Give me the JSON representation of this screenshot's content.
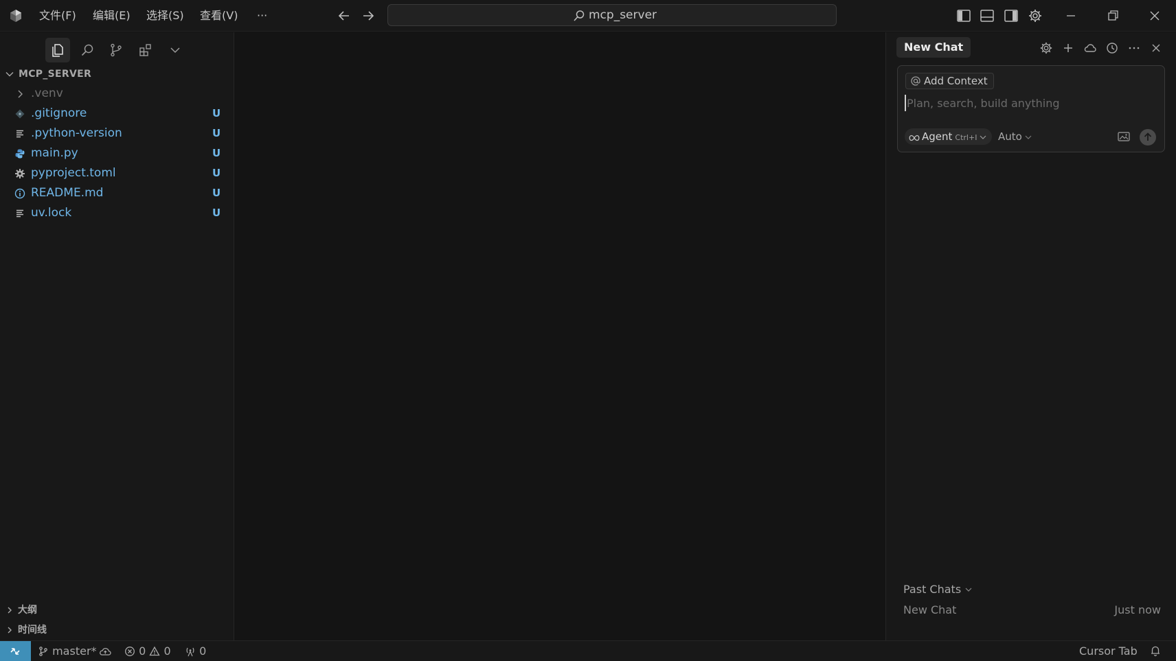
{
  "titlebar": {
    "menus": [
      "文件(F)",
      "编辑(E)",
      "选择(S)",
      "查看(V)"
    ],
    "more": "···",
    "search_text": "mcp_server"
  },
  "sidebar": {
    "explorer_title": "MCP_SERVER",
    "files": [
      {
        "name": ".venv",
        "badge": "",
        "icon": "chevron-right-icon"
      },
      {
        "name": ".gitignore",
        "badge": "U",
        "icon": "git-diamond-icon"
      },
      {
        "name": ".python-version",
        "badge": "U",
        "icon": "lines-icon"
      },
      {
        "name": "main.py",
        "badge": "U",
        "icon": "python-icon"
      },
      {
        "name": "pyproject.toml",
        "badge": "U",
        "icon": "gear-icon"
      },
      {
        "name": "README.md",
        "badge": "U",
        "icon": "info-icon"
      },
      {
        "name": "uv.lock",
        "badge": "U",
        "icon": "lines-icon"
      }
    ],
    "outline_label": "大纲",
    "timeline_label": "时间线"
  },
  "chat": {
    "tab_label": "New Chat",
    "add_context_label": "Add Context",
    "input_placeholder": "Plan, search, build anything",
    "input_value": "",
    "agent_label": "Agent",
    "agent_shortcut": "Ctrl+I",
    "model_label": "Auto",
    "past_chats_label": "Past Chats",
    "past_chats": [
      {
        "title": "New Chat",
        "time": "Just now"
      }
    ]
  },
  "statusbar": {
    "branch": "master*",
    "errors": "0",
    "warnings": "0",
    "ports": "0",
    "cursor_tab": "Cursor Tab"
  },
  "colors": {
    "accent": "#3f8fb8",
    "untracked": "#6fb6e8",
    "background": "#141414",
    "panel": "#181818"
  }
}
